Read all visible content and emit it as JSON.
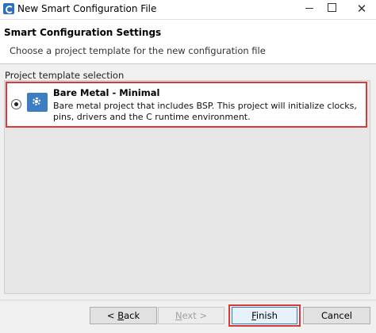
{
  "window": {
    "title": "New Smart Configuration File",
    "minimize_icon": "minimize-icon",
    "maximize_icon": "maximize-icon",
    "close_glyph": "✕"
  },
  "header": {
    "title": "Smart Configuration Settings",
    "description": "Choose a project template for the new configuration file"
  },
  "templates": {
    "section_label": "Project template selection",
    "items": [
      {
        "title": "Bare Metal - Minimal",
        "description": "Bare metal project that includes BSP. This project will initialize clocks, pins, drivers and the C runtime environment.",
        "selected": true,
        "icon": "gear-icon"
      }
    ]
  },
  "buttons": {
    "back_arrow": "< ",
    "back_mnemonic": "B",
    "back_rest": "ack",
    "next_mnemonic": "N",
    "next_rest": "ext >",
    "finish_mnemonic": "F",
    "finish_rest": "inish",
    "cancel": "Cancel"
  },
  "colors": {
    "highlight": "#d43c3c",
    "accent": "#3d7ec2"
  }
}
